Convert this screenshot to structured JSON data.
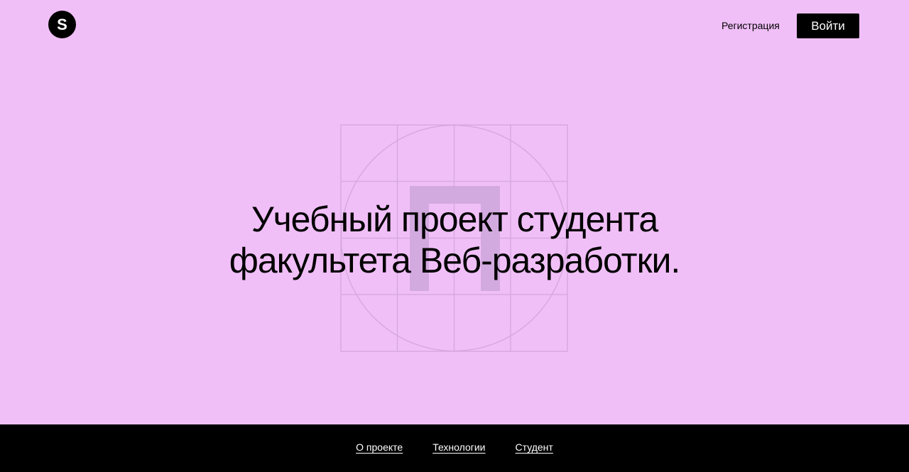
{
  "header": {
    "logo_text": "S",
    "register_label": "Регистрация",
    "login_label": "Войти"
  },
  "hero": {
    "title_line1": "Учебный проект студента",
    "title_line2": "факультета Веб-разработки."
  },
  "footer": {
    "links": [
      {
        "label": "О проекте"
      },
      {
        "label": "Технологии"
      },
      {
        "label": "Студент"
      }
    ]
  },
  "colors": {
    "background": "#f1bff8",
    "footer": "#000000",
    "decor_line": "#d7a9df",
    "decor_letter": "#d3aae0"
  },
  "icons": {
    "logo": "logo-icon",
    "decor": "grid-decor-icon"
  }
}
